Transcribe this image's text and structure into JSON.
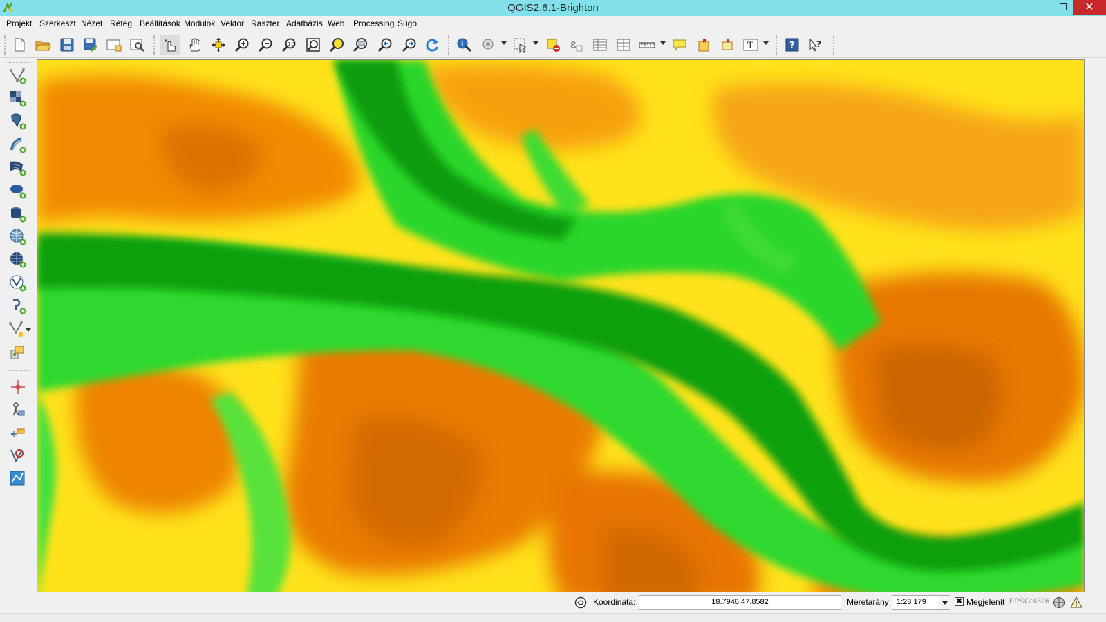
{
  "window": {
    "title": "QGIS2.6.1-Brighton",
    "minimize_glyph": "–",
    "maximize_glyph": "❐",
    "close_glyph": "✕"
  },
  "menu": {
    "items": [
      "Projekt",
      "Szerkeszt",
      "Nézet",
      "Réteg",
      "Beállítások",
      "Modulok",
      "Vektor",
      "Raszter",
      "Adatbázis",
      "Web",
      "Processing",
      "Súgó"
    ]
  },
  "toolbar": {
    "icons": [
      "new-project-icon",
      "open-project-icon",
      "save-project-icon",
      "save-as-icon",
      "new-print-composer-icon",
      "composer-manager-icon",
      "touch-zoom-icon",
      "pan-icon",
      "pan-to-selection-icon",
      "zoom-in-icon",
      "zoom-out-icon",
      "zoom-native-icon",
      "zoom-full-icon",
      "zoom-to-selection-icon",
      "zoom-to-layer-icon",
      "zoom-last-icon",
      "zoom-next-icon",
      "refresh-icon",
      "identify-icon",
      "select-by-rectangle-icon",
      "deselect-icon",
      "field-calculator-icon",
      "open-attribute-table-icon",
      "statistics-icon",
      "measure-icon",
      "map-tips-icon",
      "new-bookmark-icon",
      "show-bookmarks-icon",
      "text-annotation-icon",
      "help-contents-icon",
      "whats-this-icon"
    ]
  },
  "left_toolbar": {
    "icons": [
      "add-vector-layer-icon",
      "add-raster-layer-icon",
      "add-postgis-layer-icon",
      "add-spatialite-layer-icon",
      "add-mssql-layer-icon",
      "add-oracle-layer-icon",
      "add-db2-layer-icon",
      "add-wms-layer-icon",
      "add-wcs-layer-icon",
      "add-wfs-layer-icon",
      "add-delimited-text-layer-icon",
      "new-shapefile-layer-icon",
      "add-virtual-layer-icon",
      "georeferencer-icon",
      "coordinate-capture-icon",
      "gps-tools-icon",
      "spatial-query-icon",
      "heatmap-icon"
    ]
  },
  "status": {
    "coord_label": "Koordináta:",
    "coord_value": "18.7946,47.8582",
    "scale_label": "Méretarány",
    "scale_value": "1:28 179",
    "render_check": "✖",
    "render_label": "Megjelenít",
    "crs": "EPSG:4326"
  },
  "colors": {
    "titlebar": "#82e0ea",
    "close_button": "#c7282b",
    "raster_low": "#0aa00a",
    "raster_mid": "#fff06a",
    "raster_high": "#e07000"
  }
}
